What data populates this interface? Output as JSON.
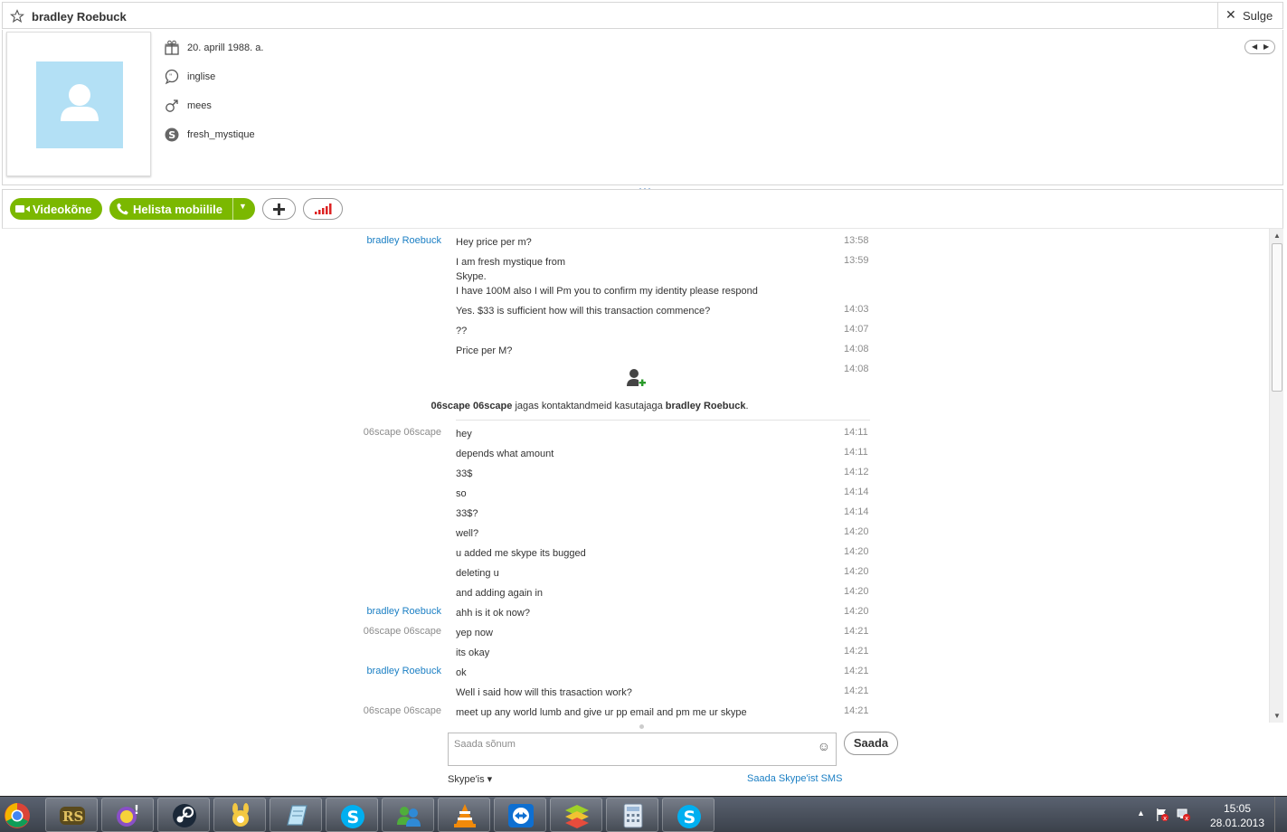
{
  "header": {
    "title": "bradley Roebuck",
    "close_label": "Sulge"
  },
  "profile": {
    "birthday": "20. aprill 1988. a.",
    "language": "inglise",
    "gender": "mees",
    "skype_name": "fresh_mystique"
  },
  "toolbar": {
    "video_label": "Videokõne",
    "call_label": "Helista mobiilile"
  },
  "messages": [
    {
      "who": "bradley Roebuck",
      "type": "b",
      "text": "Hey price per m?",
      "time": "13:58"
    },
    {
      "who": "",
      "type": "b",
      "text": "I am fresh mystique from\nSkype.\nI have 100M also I will Pm you to confirm my identity please respond",
      "time": "13:59"
    },
    {
      "who": "",
      "type": "b",
      "text": "Yes. $33 is sufficient how will this transaction commence?",
      "time": "14:03"
    },
    {
      "who": "",
      "type": "b",
      "text": "??",
      "time": "14:07"
    },
    {
      "who": "",
      "type": "b",
      "text": "Price per M?",
      "time": "14:08"
    },
    {
      "who": "",
      "type": "b",
      "text": "",
      "time": "14:08"
    },
    {
      "who": "06scape 06scape",
      "type": "o",
      "text": "hey",
      "time": "14:11"
    },
    {
      "who": "",
      "type": "o",
      "text": "depends what amount",
      "time": "14:11"
    },
    {
      "who": "",
      "type": "o",
      "text": "33$",
      "time": "14:12"
    },
    {
      "who": "",
      "type": "o",
      "text": "so",
      "time": "14:14"
    },
    {
      "who": "",
      "type": "o",
      "text": "33$?",
      "time": "14:14"
    },
    {
      "who": "",
      "type": "o",
      "text": "well?",
      "time": "14:20"
    },
    {
      "who": "",
      "type": "o",
      "text": "u added me skype its bugged",
      "time": "14:20"
    },
    {
      "who": "",
      "type": "o",
      "text": "deleting u",
      "time": "14:20"
    },
    {
      "who": "",
      "type": "o",
      "text": "and adding again in",
      "time": "14:20"
    },
    {
      "who": "bradley Roebuck",
      "type": "b",
      "text": "ahh is it ok now?",
      "time": "14:20"
    },
    {
      "who": "06scape 06scape",
      "type": "o",
      "text": "yep now",
      "time": "14:21"
    },
    {
      "who": "",
      "type": "o",
      "text": "its okay",
      "time": "14:21"
    },
    {
      "who": "bradley Roebuck",
      "type": "b",
      "text": "ok",
      "time": "14:21"
    },
    {
      "who": "",
      "type": "b",
      "text": "Well i said how will this trasaction work?",
      "time": "14:21"
    },
    {
      "who": "06scape 06scape",
      "type": "o",
      "text": "meet up any world lumb and give ur pp email and pm me ur skype",
      "time": "14:21"
    }
  ],
  "system": {
    "actor": "06scape 06scape",
    "middle": " jagas kontaktandmeid kasutajaga ",
    "target": "bradley Roebuck",
    "end": "."
  },
  "composer": {
    "placeholder": "Saada sõnum",
    "send_label": "Saada",
    "mode_label": "Skype'is ▾",
    "sms_label": "Saada Skype'ist SMS"
  },
  "taskbar": {
    "time": "15:05",
    "date": "28.01.2013"
  },
  "colors": {
    "link": "#1b7fc4",
    "green": "#7bb800",
    "avatar_bg": "#b3e0f5"
  }
}
